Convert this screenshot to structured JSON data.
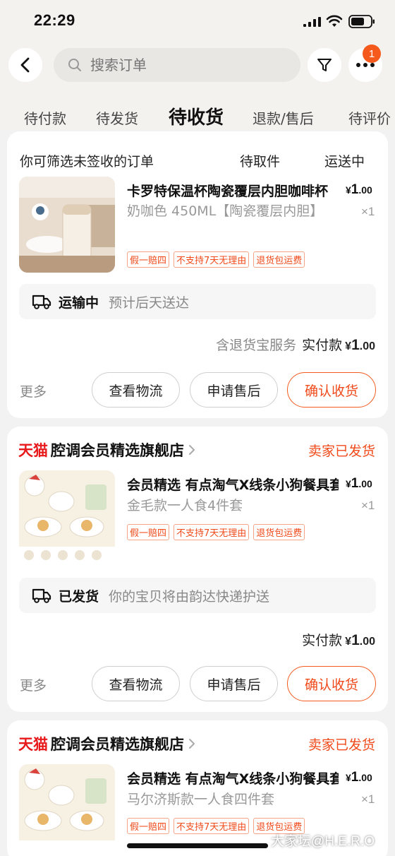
{
  "status_bar": {
    "time": "22:29"
  },
  "search": {
    "placeholder": "搜索订单"
  },
  "badge": {
    "count": "1"
  },
  "tabs": [
    {
      "label": "待付款"
    },
    {
      "label": "待发货"
    },
    {
      "label": "待收货",
      "active": true
    },
    {
      "label": "退款/售后"
    },
    {
      "label": "待评价"
    }
  ],
  "sub_filter": {
    "hint": "你可筛选未签收的订单",
    "options": [
      "待取件",
      "运送中"
    ]
  },
  "orders": [
    {
      "product": {
        "title": "卡罗特保温杯陶瓷覆层内胆咖啡杯",
        "spec": "奶咖色 450ML【陶瓷覆层内胆】",
        "price_symbol": "¥",
        "price_int": "1",
        "price_dec": ".00",
        "qty": "×1",
        "tags": [
          "假一赔四",
          "不支持7天无理由",
          "退货包运费"
        ]
      },
      "shipping": {
        "status": "运输中",
        "desc": "预计后天送达"
      },
      "payment": {
        "service": "含退货宝服务",
        "label": "实付款",
        "symbol": "¥",
        "int": "1",
        "dec": ".00"
      },
      "actions": {
        "more": "更多",
        "logistics": "查看物流",
        "after_sale": "申请售后",
        "confirm": "确认收货"
      }
    },
    {
      "shop": {
        "brand": "天猫",
        "name": "腔调会员精选旗舰店",
        "status": "卖家已发货"
      },
      "product": {
        "title": "会员精选 有点淘气X线条小狗餐具套装",
        "spec": "金毛款一人食4件套",
        "price_symbol": "¥",
        "price_int": "1",
        "price_dec": ".00",
        "qty": "×1",
        "tags": [
          "假一赔四",
          "不支持7天无理由",
          "退货包运费"
        ]
      },
      "shipping": {
        "status": "已发货",
        "desc": "你的宝贝将由韵达快递护送"
      },
      "payment": {
        "label": "实付款",
        "symbol": "¥",
        "int": "1",
        "dec": ".00"
      },
      "actions": {
        "more": "更多",
        "logistics": "查看物流",
        "after_sale": "申请售后",
        "confirm": "确认收货"
      }
    },
    {
      "shop": {
        "brand": "天猫",
        "name": "腔调会员精选旗舰店",
        "status": "卖家已发货"
      },
      "product": {
        "title": "会员精选 有点淘气X线条小狗餐具套装",
        "spec": "马尔济斯款一人食四件套",
        "price_symbol": "¥",
        "price_int": "1",
        "price_dec": ".00",
        "qty": "×1",
        "tags": [
          "假一赔四",
          "不支持7天无理由",
          "退货包运费"
        ]
      }
    }
  ],
  "watermark": "大家坛@H.E.R.O",
  "colors": {
    "accent": "#f04a1a",
    "tmall": "#e8191b",
    "background": "#f2f2f2"
  }
}
